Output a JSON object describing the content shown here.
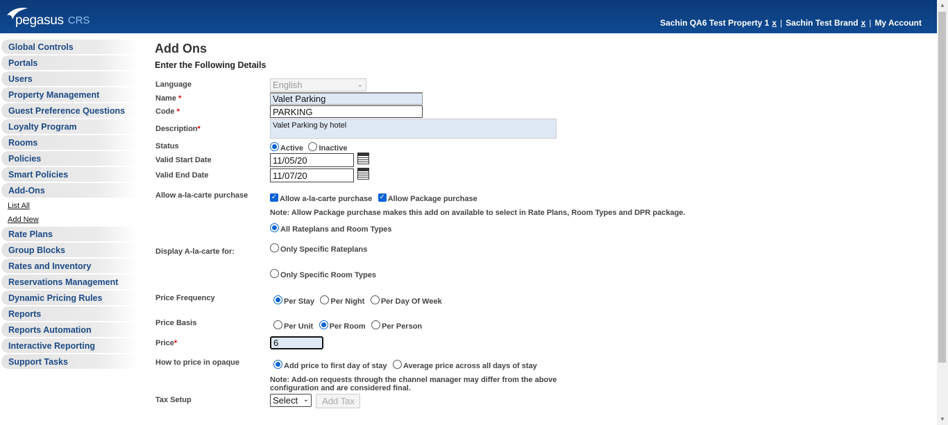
{
  "brand": {
    "name": "pegasus",
    "suffix": "CRS"
  },
  "header_links": {
    "property": "Sachin QA6 Test Property 1",
    "brand": "Sachin Test Brand",
    "close": "x",
    "sep": "|",
    "account": "My Account"
  },
  "sidebar": {
    "items": [
      "Global Controls",
      "Portals",
      "Users",
      "Property Management",
      "Guest Preference Questions",
      "Loyalty Program",
      "Rooms",
      "Policies",
      "Smart Policies",
      "Add-Ons"
    ],
    "sub_items": [
      "List All",
      "Add New"
    ],
    "items_after": [
      "Rate Plans",
      "Group Blocks",
      "Rates and Inventory",
      "Reservations Management",
      "Dynamic Pricing Rules",
      "Reports",
      "Reports Automation",
      "Interactive Reporting",
      "Support Tasks"
    ]
  },
  "page": {
    "title": "Add Ons",
    "subtitle": "Enter the Following Details"
  },
  "form": {
    "language": {
      "label": "Language",
      "value": "English"
    },
    "name": {
      "label": "Name",
      "req": "*",
      "value": "Valet Parking"
    },
    "code": {
      "label": "Code",
      "req": "*",
      "value": "PARKING"
    },
    "description": {
      "label": "Description",
      "req": "*",
      "value": "Valet Parking by hotel"
    },
    "status": {
      "label": "Status",
      "active": "Active",
      "inactive": "Inactive"
    },
    "start": {
      "label": "Valid Start Date",
      "value": "11/05/20"
    },
    "end": {
      "label": "Valid End Date",
      "value": "11/07/20"
    },
    "alacarte": {
      "label": "Allow a-la-carte purchase",
      "opt1": "Allow a-la-carte purchase",
      "opt2": "Allow Package purchase"
    },
    "note1": "Note: Allow Package purchase makes this add on available to select in Rate Plans, Room Types and DPR package.",
    "display": {
      "label": "Display A-la-carte for:",
      "opt1": "All Rateplans and Room Types",
      "opt2": "Only Specific Rateplans",
      "opt3": "Only Specific Room Types"
    },
    "frequency": {
      "label": "Price Frequency",
      "opt1": "Per Stay",
      "opt2": "Per Night",
      "opt3": "Per Day Of Week"
    },
    "basis": {
      "label": "Price Basis",
      "opt1": "Per Unit",
      "opt2": "Per Room",
      "opt3": "Per Person"
    },
    "price": {
      "label": "Price",
      "req": "*",
      "value": "6"
    },
    "opaque": {
      "label": "How to price in opaque",
      "opt1": "Add price to first day of stay",
      "opt2": "Average price across all days of stay"
    },
    "note2_line1": "Note: Add-on requests through the channel manager may differ from the above",
    "note2_line2": "configuration and are considered final.",
    "tax": {
      "label": "Tax Setup",
      "select": "Select",
      "button": "Add Tax"
    }
  }
}
